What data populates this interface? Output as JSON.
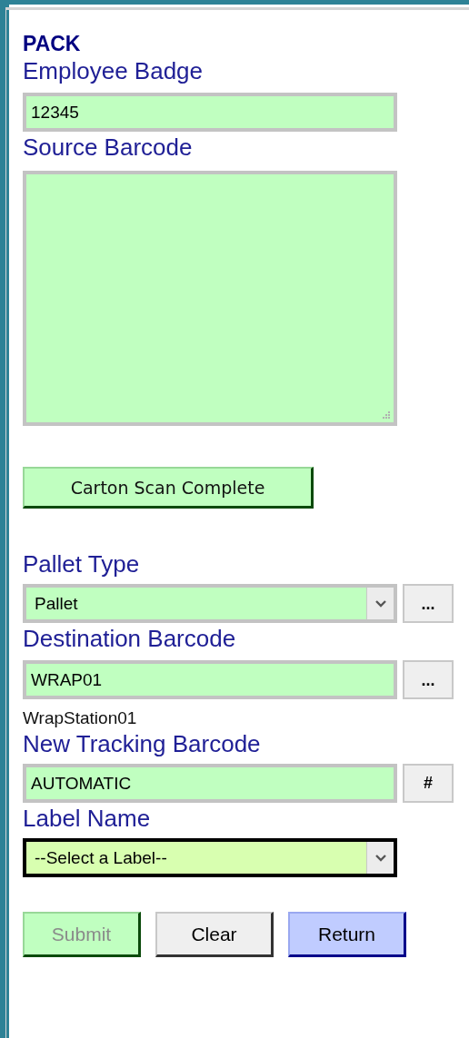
{
  "title": "PACK",
  "employee_badge": {
    "label": "Employee Badge",
    "value": "12345"
  },
  "source_barcode": {
    "label": "Source Barcode"
  },
  "carton_button": {
    "label": "Carton Scan Complete"
  },
  "pallet_type": {
    "label": "Pallet Type",
    "value": "Pallet",
    "button": "..."
  },
  "destination_barcode": {
    "label": "Destination Barcode",
    "value": "WRAP01",
    "button": "...",
    "description": "WrapStation01"
  },
  "new_tracking_barcode": {
    "label": "New Tracking Barcode",
    "value": "AUTOMATIC",
    "button": "#"
  },
  "label_name": {
    "label": "Label Name",
    "value": "--Select a Label--",
    "focused": true
  },
  "buttons": [
    {
      "label": "Submit",
      "kind": "submit",
      "disabled": true
    },
    {
      "label": "Clear",
      "kind": "clear",
      "disabled": false
    },
    {
      "label": "Return",
      "kind": "return",
      "disabled": false
    }
  ]
}
